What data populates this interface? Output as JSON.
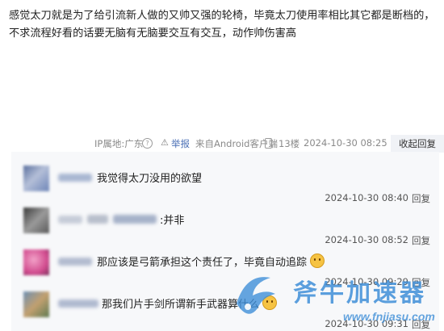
{
  "post": {
    "text_line1": "感觉太刀就是为了给引流新人做的又帅又强的轮椅，毕竟太刀使用率相比其它都是断档的，",
    "text_line2": "不求流程好看的话要无脑有无脑要交互有交互，动作帅伤害高"
  },
  "meta": {
    "ip_location": "IP属地:广东",
    "report": "举报",
    "client": "来自Android客户端",
    "floor": "13楼",
    "time": "2024-10-30 08:25",
    "collapse": "收起回复"
  },
  "replies": [
    {
      "content": "我觉得太刀没用的欲望",
      "time": "2024-10-30 08:40",
      "reply": "回复"
    },
    {
      "content": ":并非",
      "time": "2024-10-30 08:52",
      "reply": "回复"
    },
    {
      "content": "那应该是弓箭承担这个责任了，毕竟自动追踪",
      "time": "2024-10-30 09:29",
      "reply": "回复"
    },
    {
      "content": "那我们片手剑所谓新手武器算什么",
      "time": "2024-10-30 09:31",
      "reply": "回复"
    }
  ],
  "watermark": {
    "brand": "斧牛加速器",
    "site": "www.fnjiasu.com"
  },
  "colors": {
    "accent": "#4a6fb5",
    "reply_bg": "#f7f8fa",
    "collapse_bg": "#f0f2f6",
    "watermark": "#3f8fd8"
  }
}
